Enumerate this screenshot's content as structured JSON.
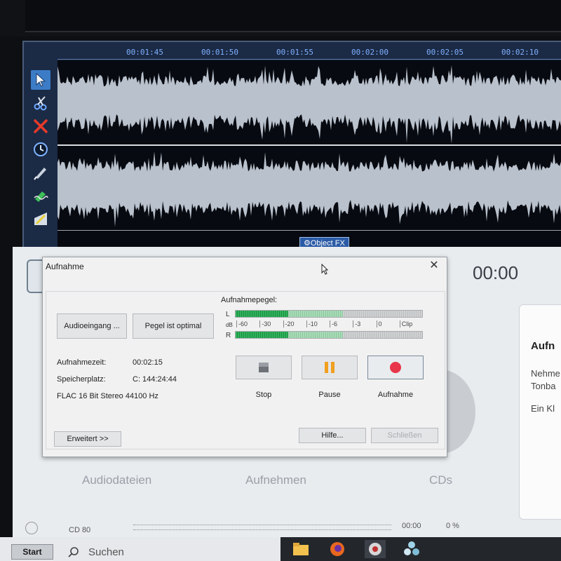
{
  "editor": {
    "timeline": [
      "00:01:45",
      "00:01:50",
      "00:01:55",
      "00:02:00",
      "00:02:05",
      "00:02:10"
    ],
    "object_fx_label": "Object FX",
    "tools": [
      "select-arrow-icon",
      "scissors-icon",
      "delete-x-icon",
      "clock-icon",
      "pen-icon",
      "eraser-icon",
      "draw-icon"
    ]
  },
  "app": {
    "time_display": "00:00",
    "right_panel": {
      "title": "Aufn",
      "line1": "Nehme",
      "line2": "Tonba",
      "line3": "Ein Kl"
    },
    "nav": {
      "audio_files": "Audiodateien",
      "record": "Aufnehmen",
      "cds": "CDs"
    },
    "status": {
      "cd_label": "CD 80",
      "time": "00:00",
      "percent": "0 %"
    }
  },
  "dialog": {
    "title": "Aufnahme",
    "audio_input_button": "Audioeingang ...",
    "level_button": "Pegel ist optimal",
    "level_meter_label": "Aufnahmepegel:",
    "channel_left": "L",
    "channel_right": "R",
    "db_label": "dB",
    "db_scale": [
      "-60",
      "-30",
      "-20",
      "-10",
      "-6",
      "-3",
      "0",
      "Clip"
    ],
    "left_level": 0.28,
    "right_level": 0.28,
    "peak_level": 0.58,
    "rec_time_label": "Aufnahmezeit:",
    "rec_time_value": "00:02:15",
    "storage_label": "Speicherplatz:",
    "storage_value": "C: 144:24:44",
    "format": "FLAC  16 Bit  Stereo  44100 Hz",
    "stop_label": "Stop",
    "pause_label": "Pause",
    "record_label": "Aufnahme",
    "advanced_button": "Erweitert >>",
    "help_button": "Hilfe...",
    "close_button": "Schließen"
  },
  "taskbar": {
    "start_label": "Start",
    "search_label": "Suchen"
  },
  "colors": {
    "meter_green": "#2fb35a",
    "record_red": "#e8364a",
    "pause_orange": "#f0a020",
    "waveform": "#b9c1cc"
  }
}
